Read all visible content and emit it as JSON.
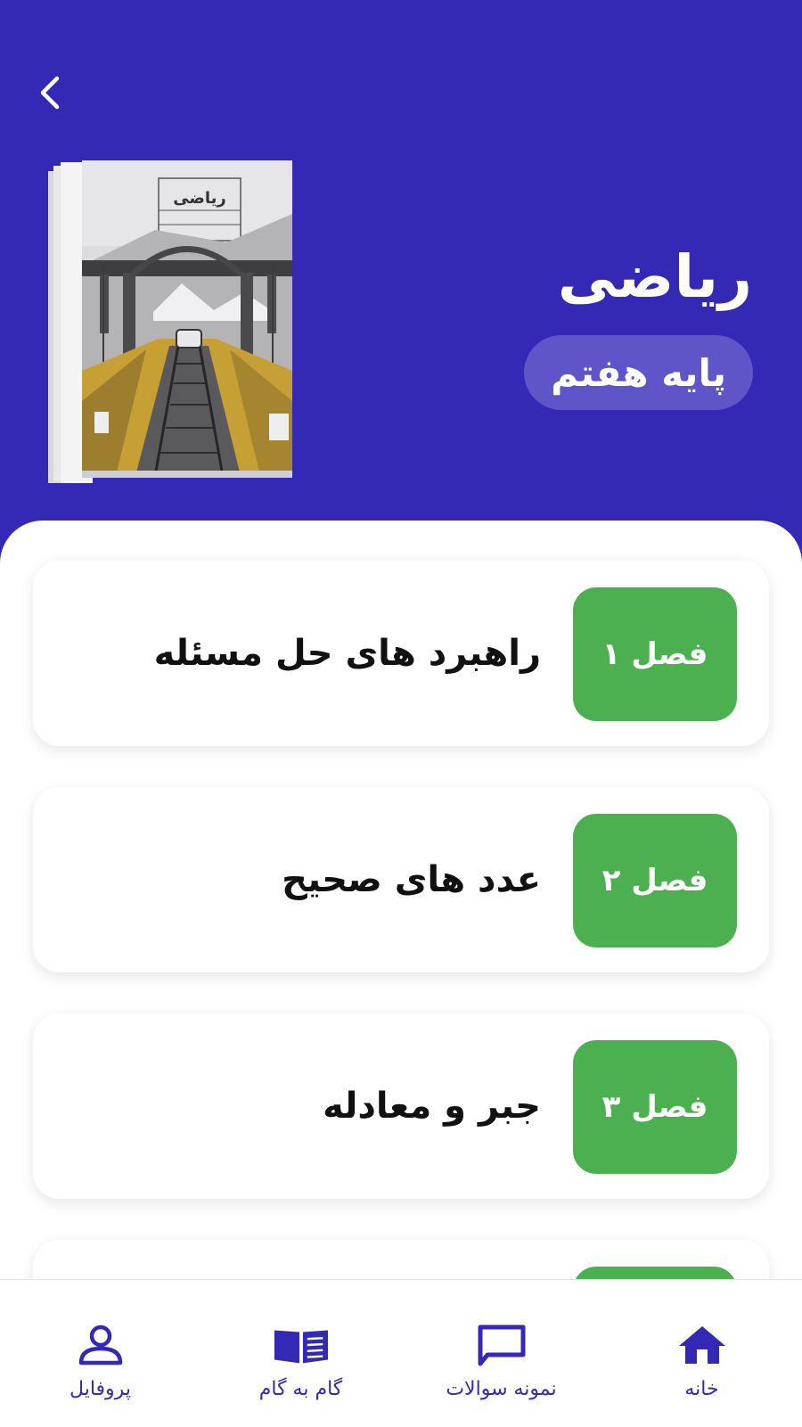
{
  "header": {
    "subject": "ریاضی",
    "grade": "پایه هفتم",
    "back_icon": "chevron-left-icon",
    "cover_title": "ریاضی",
    "background_color": "#3329b5"
  },
  "chapters": [
    {
      "badge": "فصل ۱",
      "title": "راهبرد های حل مسئله"
    },
    {
      "badge": "فصل ۲",
      "title": "عدد های صحیح"
    },
    {
      "badge": "فصل ۳",
      "title": "جبر و معادله"
    },
    {
      "badge": "",
      "title": ""
    }
  ],
  "colors": {
    "badge": "#4caf50",
    "accent": "#3329b5",
    "card": "#ffffff"
  },
  "bottom_nav": {
    "items": [
      {
        "label": "خانه",
        "icon": "home-icon",
        "active": true
      },
      {
        "label": "نمونه سوالات",
        "icon": "message-square-icon",
        "active": false
      },
      {
        "label": "گام به گام",
        "icon": "open-book-icon",
        "active": false
      },
      {
        "label": "پروفایل",
        "icon": "user-icon",
        "active": false
      }
    ]
  }
}
